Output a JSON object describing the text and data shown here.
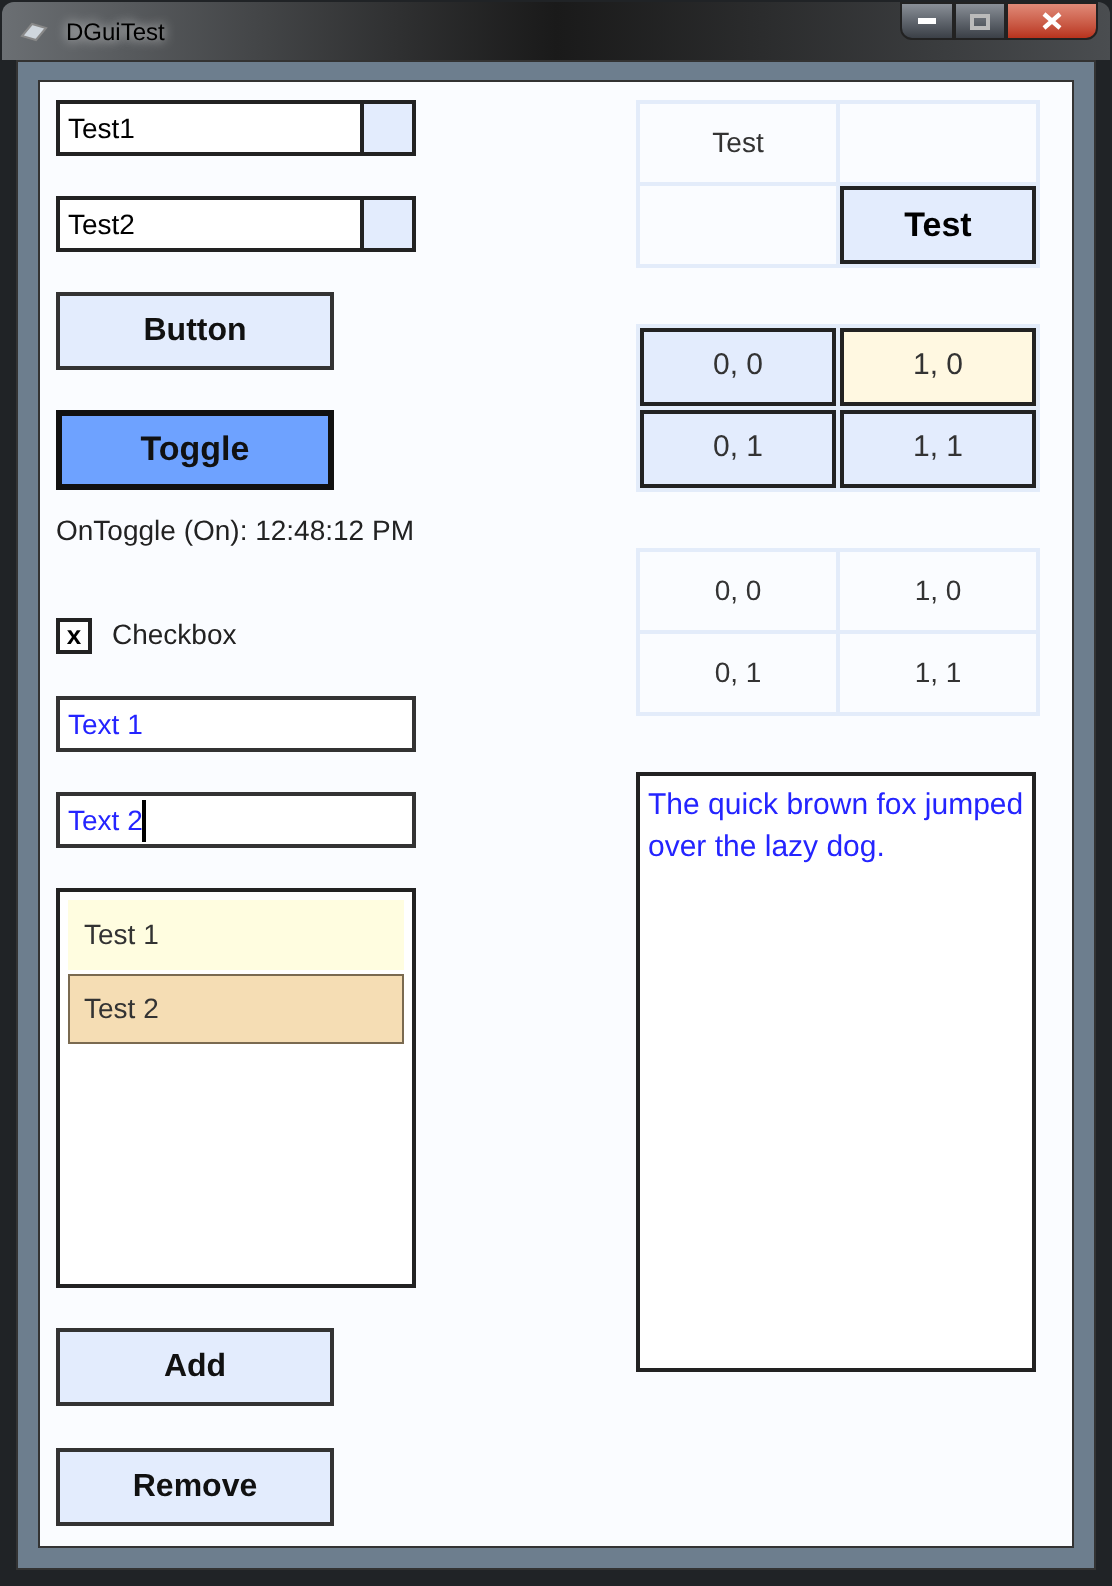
{
  "window": {
    "title": "DGuiTest"
  },
  "dropdowns": [
    {
      "value": "Test1"
    },
    {
      "value": "Test2"
    }
  ],
  "button": {
    "label": "Button"
  },
  "toggle": {
    "label": "Toggle",
    "on": true
  },
  "toggle_status": "OnToggle (On): 12:48:12 PM",
  "checkbox": {
    "label": "Checkbox",
    "checked": true,
    "mark": "x"
  },
  "text_fields": [
    {
      "value": "Text 1",
      "focused": false
    },
    {
      "value": "Text 2",
      "focused": true
    }
  ],
  "list": {
    "items": [
      {
        "label": "Test 1",
        "hovered": true,
        "selected": false
      },
      {
        "label": "Test 2",
        "hovered": false,
        "selected": true
      }
    ]
  },
  "actions": [
    {
      "label": "Add"
    },
    {
      "label": "Remove"
    }
  ],
  "grid_1": {
    "rows": [
      [
        {
          "kind": "label",
          "text": "Test"
        },
        {
          "kind": "empty"
        }
      ],
      [
        {
          "kind": "empty"
        },
        {
          "kind": "button",
          "text": "Test"
        }
      ]
    ]
  },
  "grid_2": {
    "rows": [
      [
        {
          "kind": "button",
          "text": "0, 0",
          "hovered": false
        },
        {
          "kind": "button",
          "text": "1, 0",
          "hovered": true
        }
      ],
      [
        {
          "kind": "button",
          "text": "0, 1",
          "hovered": false
        },
        {
          "kind": "button",
          "text": "1, 1",
          "hovered": false
        }
      ]
    ]
  },
  "grid_3": {
    "rows": [
      [
        {
          "kind": "label",
          "text": "0, 0"
        },
        {
          "kind": "label",
          "text": "1, 0"
        }
      ],
      [
        {
          "kind": "label",
          "text": "0, 1"
        },
        {
          "kind": "label",
          "text": "1, 1"
        }
      ]
    ]
  },
  "text_area": {
    "value": "The quick brown fox jumped over the lazy dog."
  }
}
